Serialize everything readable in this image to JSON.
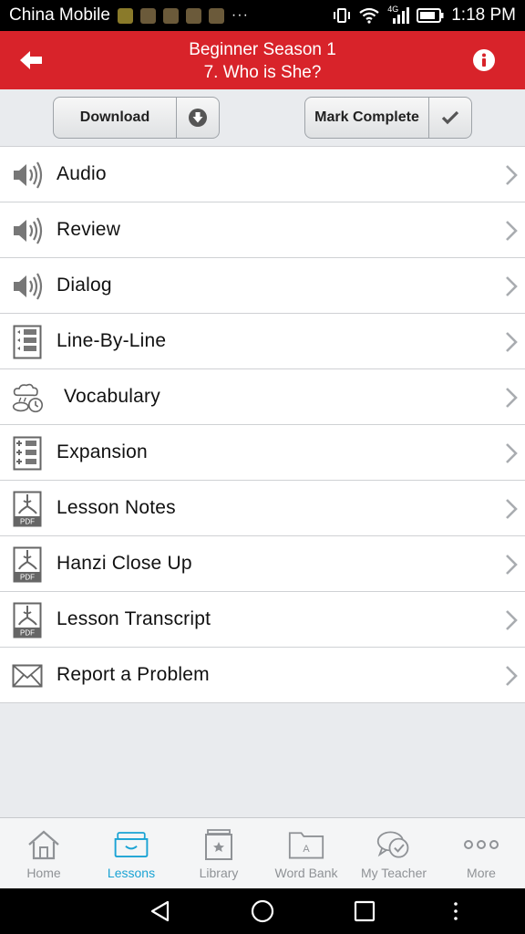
{
  "status_bar": {
    "carrier": "China Mobile",
    "dots": "···",
    "network": "4G",
    "time": "1:18 PM"
  },
  "header": {
    "title_line1": "Beginner Season 1",
    "title_line2": "7. Who is She?"
  },
  "actions": {
    "download_label": "Download",
    "mark_complete_label": "Mark Complete"
  },
  "lesson_items": [
    {
      "label": "Audio",
      "icon": "speaker-icon"
    },
    {
      "label": "Review",
      "icon": "speaker-icon"
    },
    {
      "label": "Dialog",
      "icon": "speaker-icon"
    },
    {
      "label": "Line-By-Line",
      "icon": "line-by-line-icon"
    },
    {
      "label": "Vocabulary",
      "icon": "vocabulary-icon"
    },
    {
      "label": "Expansion",
      "icon": "expansion-icon"
    },
    {
      "label": "Lesson Notes",
      "icon": "pdf-icon",
      "icon_text": "PDF"
    },
    {
      "label": "Hanzi Close Up",
      "icon": "pdf-icon",
      "icon_text": "PDF"
    },
    {
      "label": "Lesson Transcript",
      "icon": "pdf-icon",
      "icon_text": "PDF"
    },
    {
      "label": "Report a Problem",
      "icon": "envelope-icon"
    }
  ],
  "tabs": [
    {
      "label": "Home",
      "icon": "home-icon",
      "active": false
    },
    {
      "label": "Lessons",
      "icon": "lessons-icon",
      "active": true
    },
    {
      "label": "Library",
      "icon": "library-icon",
      "active": false
    },
    {
      "label": "Word Bank",
      "icon": "word-bank-icon",
      "icon_text": "A",
      "active": false
    },
    {
      "label": "My Teacher",
      "icon": "my-teacher-icon",
      "active": false
    },
    {
      "label": "More",
      "icon": "more-icon",
      "active": false
    }
  ],
  "colors": {
    "header": "#d8232a",
    "active_tab": "#1aa3d4",
    "inactive_tab": "#8f9296"
  }
}
